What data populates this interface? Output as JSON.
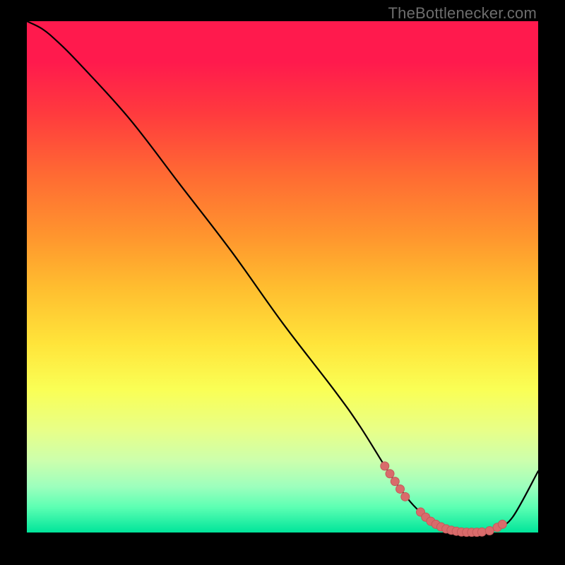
{
  "watermark": "TheBottlenecker.com",
  "colors": {
    "curve_stroke": "#000000",
    "dot_fill": "#d96b6b",
    "dot_stroke": "#c25a5a"
  },
  "chart_data": {
    "type": "line",
    "title": "",
    "xlabel": "",
    "ylabel": "",
    "xlim": [
      0,
      100
    ],
    "ylim": [
      0,
      100
    ],
    "x": [
      0,
      3,
      6,
      10,
      20,
      30,
      40,
      50,
      60,
      65,
      70,
      72,
      75,
      78,
      80,
      82,
      84,
      86,
      88,
      90,
      92,
      95,
      100
    ],
    "values": [
      100,
      98.5,
      96,
      92,
      81,
      68,
      55,
      41,
      28,
      21,
      13,
      10,
      6,
      3,
      1.5,
      0.7,
      0.2,
      0.05,
      0.05,
      0.2,
      1,
      3,
      12
    ],
    "dots": [
      {
        "x": 70,
        "y": 13
      },
      {
        "x": 71,
        "y": 11.5
      },
      {
        "x": 72,
        "y": 10
      },
      {
        "x": 73,
        "y": 8.5
      },
      {
        "x": 74,
        "y": 7
      },
      {
        "x": 77,
        "y": 4
      },
      {
        "x": 78,
        "y": 3
      },
      {
        "x": 79,
        "y": 2.2
      },
      {
        "x": 80,
        "y": 1.6
      },
      {
        "x": 81,
        "y": 1.1
      },
      {
        "x": 82,
        "y": 0.7
      },
      {
        "x": 83,
        "y": 0.45
      },
      {
        "x": 84,
        "y": 0.25
      },
      {
        "x": 85,
        "y": 0.1
      },
      {
        "x": 86,
        "y": 0.05
      },
      {
        "x": 87,
        "y": 0.05
      },
      {
        "x": 88,
        "y": 0.05
      },
      {
        "x": 89,
        "y": 0.1
      },
      {
        "x": 90.5,
        "y": 0.35
      },
      {
        "x": 92,
        "y": 1
      },
      {
        "x": 93,
        "y": 1.6
      }
    ]
  }
}
